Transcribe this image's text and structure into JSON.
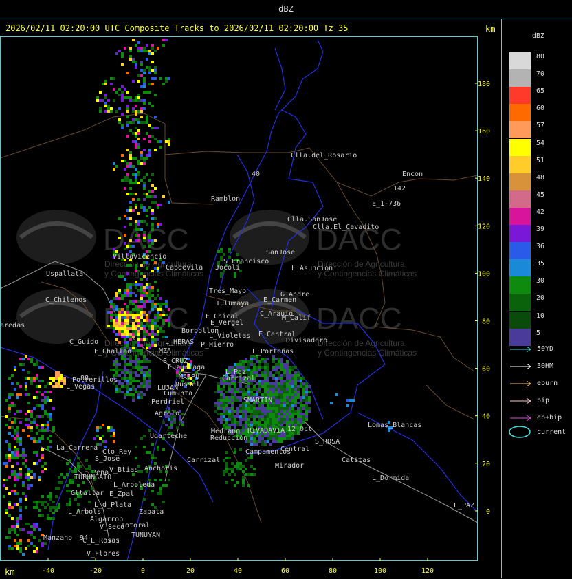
{
  "window": {
    "top_title": "dBZ"
  },
  "map": {
    "title": "2026/02/11 02:20:00 UTC Composite Tracks to 2026/02/11 02:20:00 Tz 35",
    "unit_top": "km",
    "unit_bottom": "km",
    "x_ticks": [
      "-40",
      "-20",
      "0",
      "20",
      "40",
      "60",
      "80",
      "100",
      "120"
    ],
    "y_ticks": [
      "180",
      "160",
      "140",
      "120",
      "100",
      "80",
      "60",
      "40",
      "20",
      "0"
    ],
    "watermark": {
      "name": "DACC",
      "line1": "Dirección de Agricultura",
      "line2": "y Contingencias Climáticas"
    },
    "places": [
      {
        "name": "Clla.del_Rosario"
      },
      {
        "name": "Encon"
      },
      {
        "name": "142"
      },
      {
        "name": "E_1-736"
      },
      {
        "name": "Ramblon"
      },
      {
        "name": "Clla.SanJose"
      },
      {
        "name": "Clla.El_Cavadito"
      },
      {
        "name": "40"
      },
      {
        "name": "Uspallata"
      },
      {
        "name": "Villavicencio"
      },
      {
        "name": "Capdevila"
      },
      {
        "name": "S_Francisco"
      },
      {
        "name": "SanJose"
      },
      {
        "name": "Jocoli"
      },
      {
        "name": "L_Asuncion"
      },
      {
        "name": "Tres_Mayo"
      },
      {
        "name": "G_Andre"
      },
      {
        "name": "E_Carmen"
      },
      {
        "name": "C_Chilenos"
      },
      {
        "name": "Tulumaya"
      },
      {
        "name": "C_Arauio"
      },
      {
        "name": "M_Calif"
      },
      {
        "name": "aredas"
      },
      {
        "name": "E_Chical"
      },
      {
        "name": "E_Vergel"
      },
      {
        "name": "Borbollon"
      },
      {
        "name": "L_Violetas"
      },
      {
        "name": "E_Central"
      },
      {
        "name": "Divisadero"
      },
      {
        "name": "L_HERAS"
      },
      {
        "name": "P_Hierro"
      },
      {
        "name": "C_Guido"
      },
      {
        "name": "E_Challao"
      },
      {
        "name": "MZA"
      },
      {
        "name": "L_Porteñas"
      },
      {
        "name": "S_CRUZ"
      },
      {
        "name": "Luzuriaga"
      },
      {
        "name": "L_Paz"
      },
      {
        "name": "MAIPU"
      },
      {
        "name": "Russel"
      },
      {
        "name": "Potrerillos"
      },
      {
        "name": "Carrizal"
      },
      {
        "name": "L_Vegas"
      },
      {
        "name": "LUJAN"
      },
      {
        "name": "Cumunta"
      },
      {
        "name": "SMARTIN"
      },
      {
        "name": "Perdriel"
      },
      {
        "name": "Agrelo"
      },
      {
        "name": "Lomas_Blancas"
      },
      {
        "name": "Ugarteche"
      },
      {
        "name": "RIVADAVIA"
      },
      {
        "name": "12_Oct"
      },
      {
        "name": "S_ROSA"
      },
      {
        "name": "La_Carrera"
      },
      {
        "name": "Cto_Rey"
      },
      {
        "name": "Medrano"
      },
      {
        "name": "Reducción"
      },
      {
        "name": "S_Jose"
      },
      {
        "name": "Campamentos"
      },
      {
        "name": "Central"
      },
      {
        "name": "Catitas"
      },
      {
        "name": "Carrizal"
      },
      {
        "name": "Mirador"
      },
      {
        "name": "E_Pena"
      },
      {
        "name": "V_Btias"
      },
      {
        "name": "Anchoris"
      },
      {
        "name": "TUPUNGATO"
      },
      {
        "name": "L_Dormida"
      },
      {
        "name": "L_Arboleda"
      },
      {
        "name": "Gltallar"
      },
      {
        "name": "E_Zpal"
      },
      {
        "name": "L_d_Plata"
      },
      {
        "name": "L_Arbols"
      },
      {
        "name": "Zapata"
      },
      {
        "name": "L_PAZ"
      },
      {
        "name": "V_Seco"
      },
      {
        "name": "Totoral"
      },
      {
        "name": "Manzano"
      },
      {
        "name": "TUNUYAN"
      },
      {
        "name": "C_L_Rosas"
      },
      {
        "name": "94"
      },
      {
        "name": "V_Flores"
      },
      {
        "name": "Algarrob"
      },
      {
        "name": "88"
      }
    ]
  },
  "legend": {
    "title": "dBZ",
    "scale": [
      {
        "value": "80",
        "color": "#d9d9d9"
      },
      {
        "value": "70",
        "color": "#b3b3b3"
      },
      {
        "value": "65",
        "color": "#ff3a2a"
      },
      {
        "value": "60",
        "color": "#ff6a00"
      },
      {
        "value": "57",
        "color": "#ff9a5a"
      },
      {
        "value": "54",
        "color": "#ffff00"
      },
      {
        "value": "51",
        "color": "#ffcc2a"
      },
      {
        "value": "48",
        "color": "#d8923a"
      },
      {
        "value": "45",
        "color": "#d46a8a"
      },
      {
        "value": "42",
        "color": "#d8149a"
      },
      {
        "value": "39",
        "color": "#7a18d8"
      },
      {
        "value": "36",
        "color": "#2a5ae8"
      },
      {
        "value": "35",
        "color": "#1a8ad8"
      },
      {
        "value": "30",
        "color": "#0e8a0e"
      },
      {
        "value": "20",
        "color": "#0a620a"
      },
      {
        "value": "10",
        "color": "#0a4a0a"
      },
      {
        "value": "5",
        "color": "#4a3a9a"
      }
    ],
    "tracks": [
      {
        "label": "50YD",
        "color": "#40d8d8"
      },
      {
        "label": "30HM",
        "color": "#ffffff"
      },
      {
        "label": "eburn",
        "color": "#f0c070"
      },
      {
        "label": "bip",
        "color": "#ffc8c8"
      },
      {
        "label": "eb+bip",
        "color": "#e040e0"
      }
    ],
    "current": {
      "label": "current",
      "color": "#40e8e8"
    }
  }
}
